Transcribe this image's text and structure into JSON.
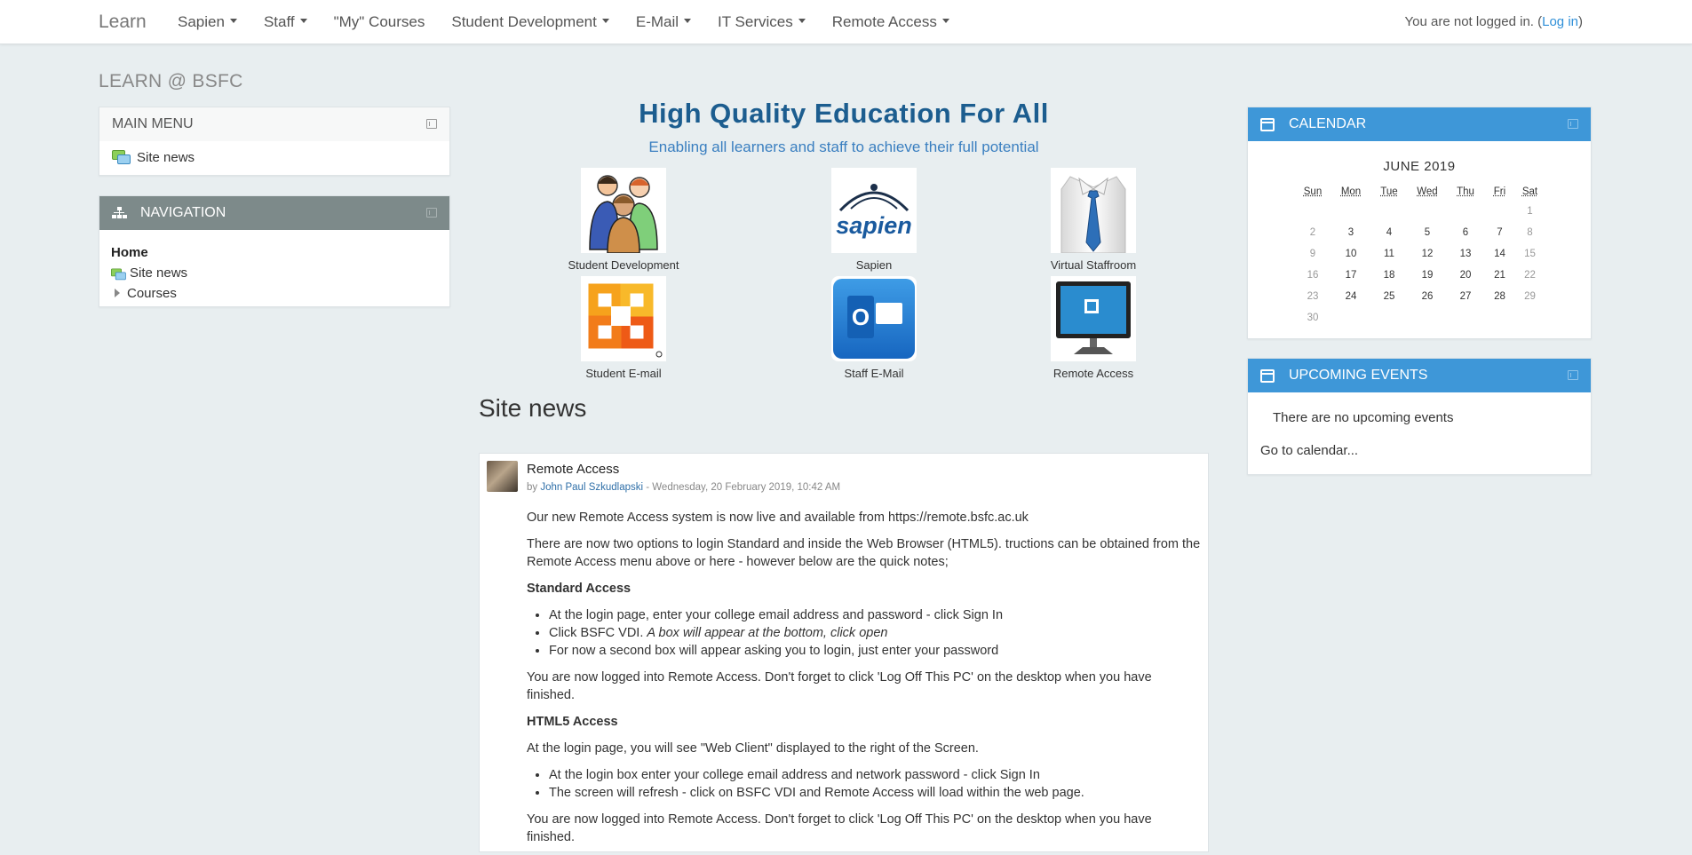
{
  "nav": {
    "brand": "Learn",
    "menu": [
      "Sapien",
      "Staff",
      "\"My\" Courses",
      "Student Development",
      "E-Mail",
      "IT Services",
      "Remote Access"
    ],
    "login_text": "You are not logged in. (",
    "login_link": "Log in",
    "login_close": ")"
  },
  "site_heading": "LEARN @ BSFC",
  "main_menu": {
    "title": "MAIN MENU",
    "item": "Site news"
  },
  "navigation": {
    "title": "NAVIGATION",
    "home": "Home",
    "site_news": "Site news",
    "courses": "Courses"
  },
  "hero": {
    "title": "High Quality Education For All",
    "subtitle": "Enabling all learners and staff to achieve their full potential"
  },
  "tiles": [
    {
      "label": "Student Development",
      "icon": "students-icon"
    },
    {
      "label": "Sapien",
      "icon": "sapien-logo",
      "logo_text": "sapien"
    },
    {
      "label": "Virtual Staffroom",
      "icon": "shirt-tie-icon"
    },
    {
      "label": "Student E-mail",
      "icon": "office-logo"
    },
    {
      "label": "Staff E-Mail",
      "icon": "outlook-icon",
      "logo_text": "O"
    },
    {
      "label": "Remote Access",
      "icon": "monitor-icon"
    }
  ],
  "site_news": {
    "heading": "Site news",
    "post": {
      "subject": "Remote Access",
      "by": "by ",
      "author": "John Paul Szkudlapski",
      "date": " - Wednesday, 20 February 2019, 10:42 AM",
      "p1": "Our new Remote Access system is now live and available from https://remote.bsfc.ac.uk",
      "p2": "There are now two options to login Standard and inside the Web Browser (HTML5). tructions can be obtained from the Remote Access menu above or here - however below are the quick notes;",
      "h1": "Standard Access",
      "list1": [
        "At the login page, enter your college email address and password - click Sign In",
        "Click BSFC VDI. ",
        "For now a second box will appear asking you to login, just enter your password"
      ],
      "list1_italic": "A box will appear at the bottom, click open",
      "p3": "You are now logged into Remote Access. Don't forget to click 'Log Off This PC' on the desktop when you have finished.",
      "h2": "HTML5 Access",
      "p4": "At the login page, you will see \"Web Client\" displayed to the right of the Screen.",
      "list2": [
        "At the login box enter your college email address and network password - click Sign In",
        "The screen will refresh - click on BSFC VDI and Remote Access will load within the web page."
      ],
      "p5": "You are now logged into Remote Access. Don't forget to click 'Log Off This PC' on the desktop when you have finished."
    }
  },
  "calendar": {
    "title": "CALENDAR",
    "month": "JUNE 2019",
    "days": [
      "Sun",
      "Mon",
      "Tue",
      "Wed",
      "Thu",
      "Fri",
      "Sat"
    ],
    "weeks": [
      [
        "",
        "",
        "",
        "",
        "",
        "",
        "1"
      ],
      [
        "2",
        "3",
        "4",
        "5",
        "6",
        "7",
        "8"
      ],
      [
        "9",
        "10",
        "11",
        "12",
        "13",
        "14",
        "15"
      ],
      [
        "16",
        "17",
        "18",
        "19",
        "20",
        "21",
        "22"
      ],
      [
        "23",
        "24",
        "25",
        "26",
        "27",
        "28",
        "29"
      ],
      [
        "30",
        "",
        "",
        "",
        "",
        "",
        ""
      ]
    ]
  },
  "upcoming": {
    "title": "UPCOMING EVENTS",
    "none": "There are no upcoming events",
    "link": "Go to calendar..."
  },
  "colors": {
    "accent": "#3e97d8",
    "nav_grey": "#7d8a8a",
    "title_blue": "#1c5d8f",
    "link": "#2f8fd8"
  }
}
